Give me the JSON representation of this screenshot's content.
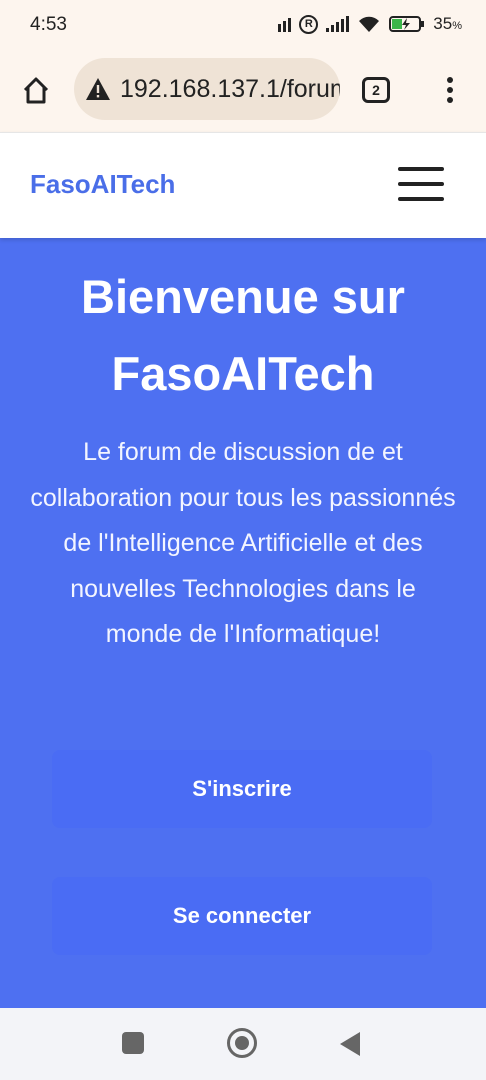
{
  "status_bar": {
    "time": "4:53",
    "battery_percent": "35",
    "battery_unit": "%"
  },
  "browser": {
    "url": "192.168.137.1/forum",
    "tab_count": "2"
  },
  "nav": {
    "brand": "FasoAITech"
  },
  "hero": {
    "title": "Bienvenue sur FasoAITech",
    "description": "Le forum de discussion de et collaboration pour tous les passionnés de l'Intelligence Artificielle et des nouvelles Technologies dans le monde de l'Informatique!",
    "signup_label": "S'inscrire",
    "login_label": "Se connecter"
  },
  "colors": {
    "brand": "#4a6ee8",
    "hero_bg": "#4e70f1",
    "button_bg": "#4a6cf4"
  }
}
